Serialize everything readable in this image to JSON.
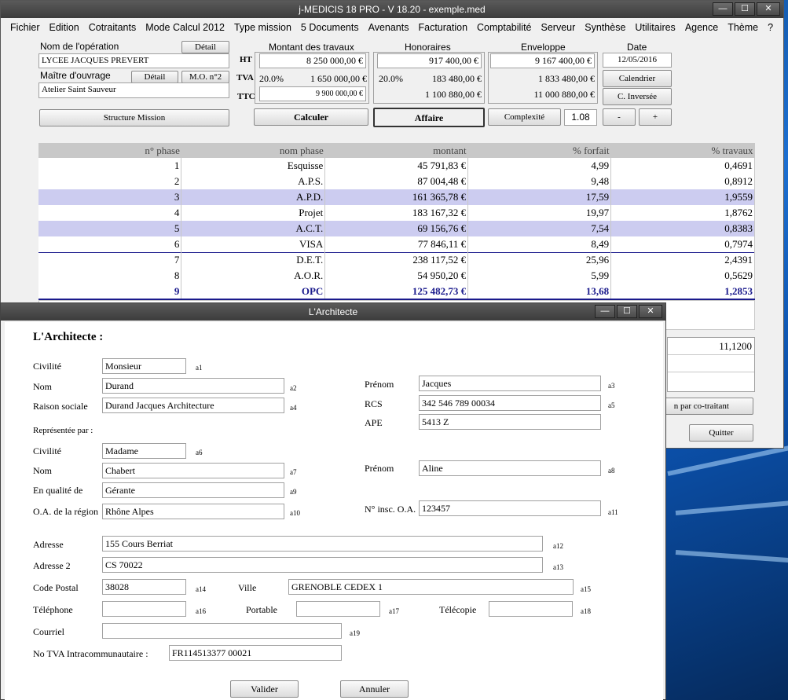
{
  "main_window": {
    "title": "j-MEDICIS 18 PRO - V 18.20 - exemple.med",
    "controls": {
      "minimize": "—",
      "maximize": "☐",
      "close": "✕"
    }
  },
  "menu": [
    "Fichier",
    "Edition",
    "Cotraitants",
    "Mode Calcul 2012",
    "Type mission",
    "5 Documents",
    "Avenants",
    "Facturation",
    "Comptabilité",
    "Serveur",
    "Synthèse",
    "Utilitaires",
    "Agence",
    "Thème",
    "?"
  ],
  "operation": {
    "label": "Nom de l'opération",
    "detail_button": "Détail",
    "value": "LYCEE JACQUES PREVERT",
    "maitre_label": "Maître d'ouvrage",
    "detail2_button": "Détail",
    "mo_button": "M.O. n°2",
    "maitre_value": "Atelier Saint Sauveur",
    "structure_button": "Structure Mission"
  },
  "montant": {
    "header": "Montant des travaux",
    "ht_label": "HT",
    "tva_label": "TVA",
    "ttc_label": "TTC",
    "ht": "8 250 000,00 €",
    "tva_rate": "20.0%",
    "tva": "1 650 000,00 €",
    "ttc": "9 900 000,00 €"
  },
  "honoraires": {
    "header": "Honoraires",
    "ht": "917 400,00 €",
    "tva_rate": "20.0%",
    "tva": "183 480,00 €",
    "ttc": "1 100 880,00 €"
  },
  "enveloppe": {
    "header": "Enveloppe",
    "ht": "9 167 400,00 €",
    "tva": "1 833 480,00 €",
    "ttc": "11 000 880,00 €"
  },
  "date": {
    "header": "Date",
    "value": "12/05/2016",
    "calendrier_button": "Calendrier",
    "inverse_button": "C. Inversée",
    "minus_button": "-",
    "plus_button": "+"
  },
  "actions": {
    "calculer": "Calculer",
    "affaire": "Affaire",
    "complexite_button": "Complexité",
    "complexite_value": "1.08"
  },
  "phase_table": {
    "headers": [
      "n° phase",
      "nom phase",
      "montant",
      "% forfait",
      "% travaux"
    ],
    "rows": [
      [
        "1",
        "Esquisse",
        "45 791,83 €",
        "4,99",
        "0,4691"
      ],
      [
        "2",
        "A.P.S.",
        "87 004,48 €",
        "9,48",
        "0,8912"
      ],
      [
        "3",
        "A.P.D.",
        "161 365,78 €",
        "17,59",
        "1,9559"
      ],
      [
        "4",
        "Projet",
        "183 167,32 €",
        "19,97",
        "1,8762"
      ],
      [
        "5",
        "A.C.T.",
        "69 156,76 €",
        "7,54",
        "0,8383"
      ],
      [
        "6",
        "VISA",
        "77 846,11 €",
        "8,49",
        "0,7974"
      ],
      [
        "7",
        "D.E.T.",
        "238 117,52 €",
        "25,96",
        "2,4391"
      ],
      [
        "8",
        "A.O.R.",
        "54 950,20 €",
        "5,99",
        "0,5629"
      ],
      [
        "9",
        "OPC",
        "125 482,73 €",
        "13,68",
        "1,2853"
      ]
    ]
  },
  "side_panel": {
    "total": "11,1200",
    "cotraitant_button": "n par co-traitant",
    "quitter_button": "Quitter"
  },
  "dialog": {
    "title": "L'Architecte",
    "heading": "L'Architecte :",
    "civilite_label": "Civilité",
    "civilite": "Monsieur",
    "civilite_code": "a1",
    "nom_label": "Nom",
    "nom": "Durand",
    "nom_code": "a2",
    "prenom_label": "Prénom",
    "prenom": "Jacques",
    "prenom_code": "a3",
    "raison_label": "Raison sociale",
    "raison": "Durand Jacques Architecture",
    "raison_code": "a4",
    "rcs_label": "RCS",
    "rcs": "342 546 789 00034",
    "rcs_code": "a5",
    "ape_label": "APE",
    "ape": "5413 Z",
    "represente_label": "Représentée par :",
    "rep_civilite_label": "Civilité",
    "rep_civilite": "Madame",
    "rep_civilite_code": "a6",
    "rep_nom_label": "Nom",
    "rep_nom": "Chabert",
    "rep_nom_code": "a7",
    "rep_prenom_label": "Prénom",
    "rep_prenom": "Aline",
    "rep_prenom_code": "a8",
    "qualite_label": "En qualité de",
    "qualite": "Gérante",
    "qualite_code": "a9",
    "oa_label": "O.A. de la région",
    "oa": "Rhône Alpes",
    "oa_code": "a10",
    "insc_label": "N° insc. O.A.",
    "insc": "123457",
    "insc_code": "a11",
    "adresse_label": "Adresse",
    "adresse": "155 Cours Berriat",
    "adresse_code": "a12",
    "adresse2_label": "Adresse 2",
    "adresse2": "CS 70022",
    "adresse2_code": "a13",
    "cp_label": "Code Postal",
    "cp": "38028",
    "cp_code": "a14",
    "ville_label": "Ville",
    "ville": "GRENOBLE CEDEX 1",
    "ville_code": "a15",
    "tel_label": "Téléphone",
    "tel": "",
    "tel_code": "a16",
    "portable_label": "Portable",
    "portable": "",
    "portable_code": "a17",
    "telecopie_label": "Télécopie",
    "telecopie": "",
    "telecopie_code": "a18",
    "courriel_label": "Courriel",
    "courriel": "",
    "courriel_code": "a19",
    "tva_label": "No TVA Intracommunautaire :",
    "tva": "FR114513377 00021",
    "valider_button": "Valider",
    "annuler_button": "Annuler"
  }
}
